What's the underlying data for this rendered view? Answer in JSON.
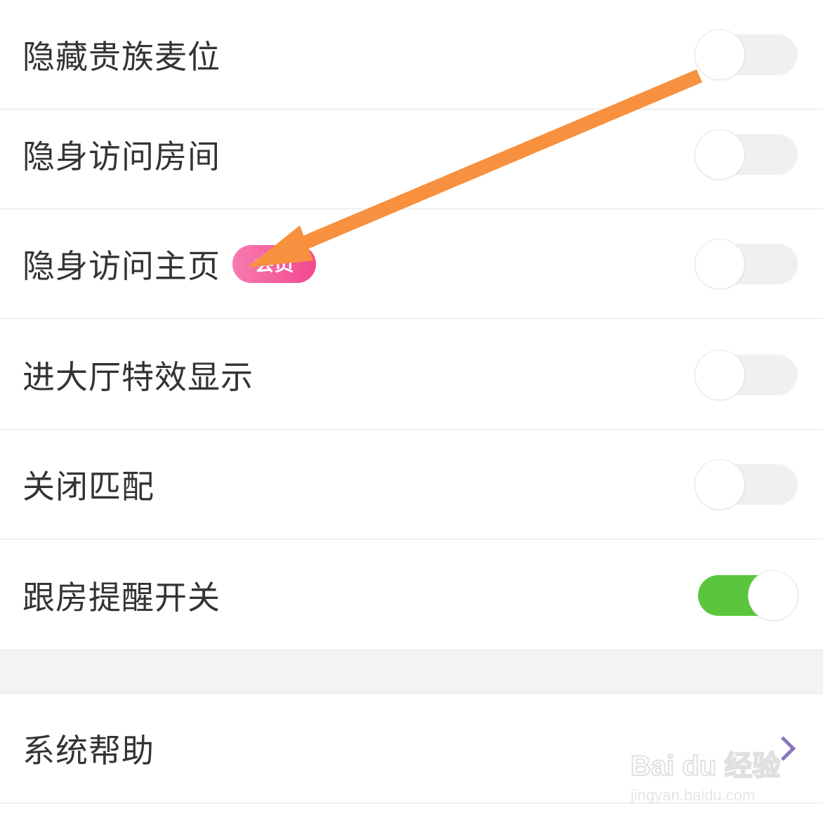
{
  "settings": {
    "rows": [
      {
        "label": "隐藏贵族麦位",
        "toggle_on": false
      },
      {
        "label": "隐身访问房间",
        "toggle_on": false
      },
      {
        "label": "隐身访问主页",
        "badge": "会员",
        "toggle_on": false
      },
      {
        "label": "进大厅特效显示",
        "toggle_on": false
      },
      {
        "label": "关闭匹配",
        "toggle_on": false
      },
      {
        "label": "跟房提醒开关",
        "toggle_on": true
      }
    ],
    "help": {
      "label": "系统帮助"
    }
  },
  "annotation": {
    "arrow_color": "#f7913f"
  },
  "colors": {
    "toggle_on": "#5bc63d",
    "toggle_off": "#f0f0f0",
    "badge": "#f2488f",
    "chevron": "#8a76c0"
  },
  "watermark": {
    "logo": "Bai du 经验",
    "url": "jingyan.baidu.com"
  }
}
